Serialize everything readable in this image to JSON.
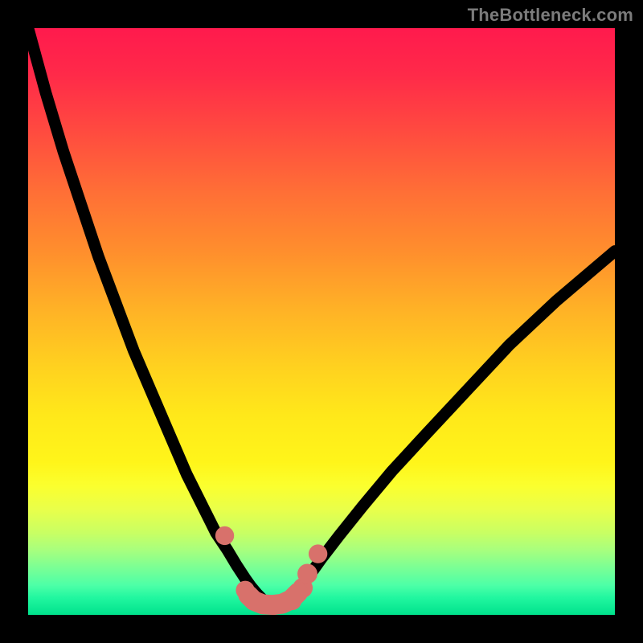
{
  "watermark": "TheBottleneck.com",
  "chart_data": {
    "type": "line",
    "title": "",
    "xlabel": "",
    "ylabel": "",
    "xlim": [
      0,
      100
    ],
    "ylim": [
      0,
      100
    ],
    "grid": false,
    "legend": false,
    "annotations": [],
    "series": [
      {
        "name": "left-curve",
        "x": [
          0,
          3,
          6,
          9,
          12,
          15,
          18,
          21,
          24,
          27,
          30,
          32,
          34,
          35.5,
          37,
          38,
          39,
          40,
          41,
          42
        ],
        "y": [
          100,
          89,
          79,
          70,
          61,
          53,
          45,
          38,
          31,
          24,
          18,
          14,
          11,
          8.5,
          6.2,
          4.8,
          3.6,
          2.6,
          2.0,
          1.7
        ]
      },
      {
        "name": "right-curve",
        "x": [
          42,
          43,
          44,
          45,
          46.5,
          48,
          50,
          53,
          57,
          62,
          68,
          75,
          82,
          90,
          100
        ],
        "y": [
          1.7,
          2.0,
          2.6,
          3.6,
          5.0,
          6.8,
          9.6,
          13.5,
          18.5,
          24.5,
          31,
          38.5,
          46,
          53.5,
          62
        ]
      },
      {
        "name": "markers",
        "type": "scatter",
        "points": [
          {
            "x": 33.5,
            "y": 13.5,
            "r": 1.6
          },
          {
            "x": 37.0,
            "y": 4.2,
            "r": 1.6
          },
          {
            "x": 38.8,
            "y": 2.4,
            "r": 1.6
          },
          {
            "x": 42.0,
            "y": 1.6,
            "r": 1.6
          },
          {
            "x": 45.0,
            "y": 2.4,
            "r": 1.6
          },
          {
            "x": 46.8,
            "y": 4.6,
            "r": 1.7
          },
          {
            "x": 47.6,
            "y": 7.0,
            "r": 1.7
          },
          {
            "x": 49.4,
            "y": 10.4,
            "r": 1.6
          }
        ],
        "marker_color": "#d8716b"
      },
      {
        "name": "trough-band",
        "type": "line",
        "x": [
          37.5,
          38.5,
          40,
          41.7,
          43.3,
          44.8,
          46.0
        ],
        "y": [
          3.4,
          2.4,
          1.8,
          1.7,
          1.9,
          2.6,
          3.8
        ],
        "stroke": "#d8716b",
        "stroke_width": 3.4
      }
    ],
    "curve_stroke": "#000000",
    "curve_stroke_width": 2
  }
}
